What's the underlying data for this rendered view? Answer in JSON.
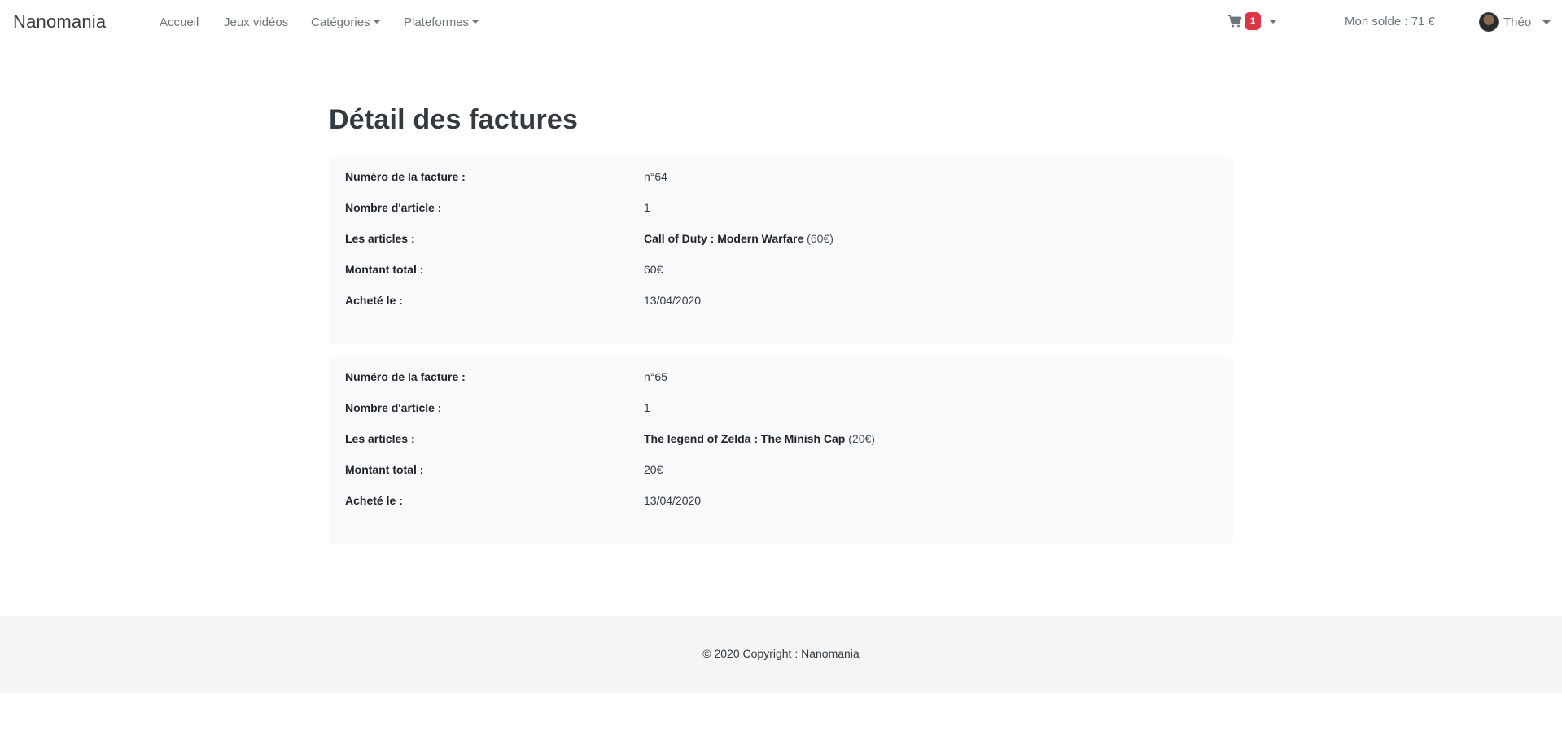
{
  "navbar": {
    "brand": "Nanomania",
    "links": {
      "home": "Accueil",
      "games": "Jeux vidéos",
      "categories": "Catégories",
      "platforms": "Plateformes"
    },
    "cart_count": "1",
    "balance": "Mon solde : 71 €",
    "user_name": "Théo"
  },
  "main": {
    "title": "Détail des factures",
    "labels": {
      "invoice_number": "Numéro de la facture :",
      "item_count": "Nombre d'article :",
      "items": "Les articles :",
      "total": "Montant total :",
      "purchased_on": "Acheté le :"
    },
    "invoices": [
      {
        "number": "n°64",
        "item_count": "1",
        "article_name": "Call of Duty : Modern Warfare",
        "article_price": "(60€)",
        "total": "60€",
        "date": "13/04/2020"
      },
      {
        "number": "n°65",
        "item_count": "1",
        "article_name": "The legend of Zelda : The Minish Cap",
        "article_price": "(20€)",
        "total": "20€",
        "date": "13/04/2020"
      }
    ]
  },
  "footer": {
    "text": "© 2020 Copyright : Nanomania"
  },
  "colors": {
    "badge": "#dc3545",
    "card_bg": "#f8f9fa",
    "footer_bg": "#f5f5f5"
  },
  "icons": {
    "cart": "shopping-cart-icon",
    "caret": "caret-down-icon",
    "avatar": "user-avatar"
  }
}
